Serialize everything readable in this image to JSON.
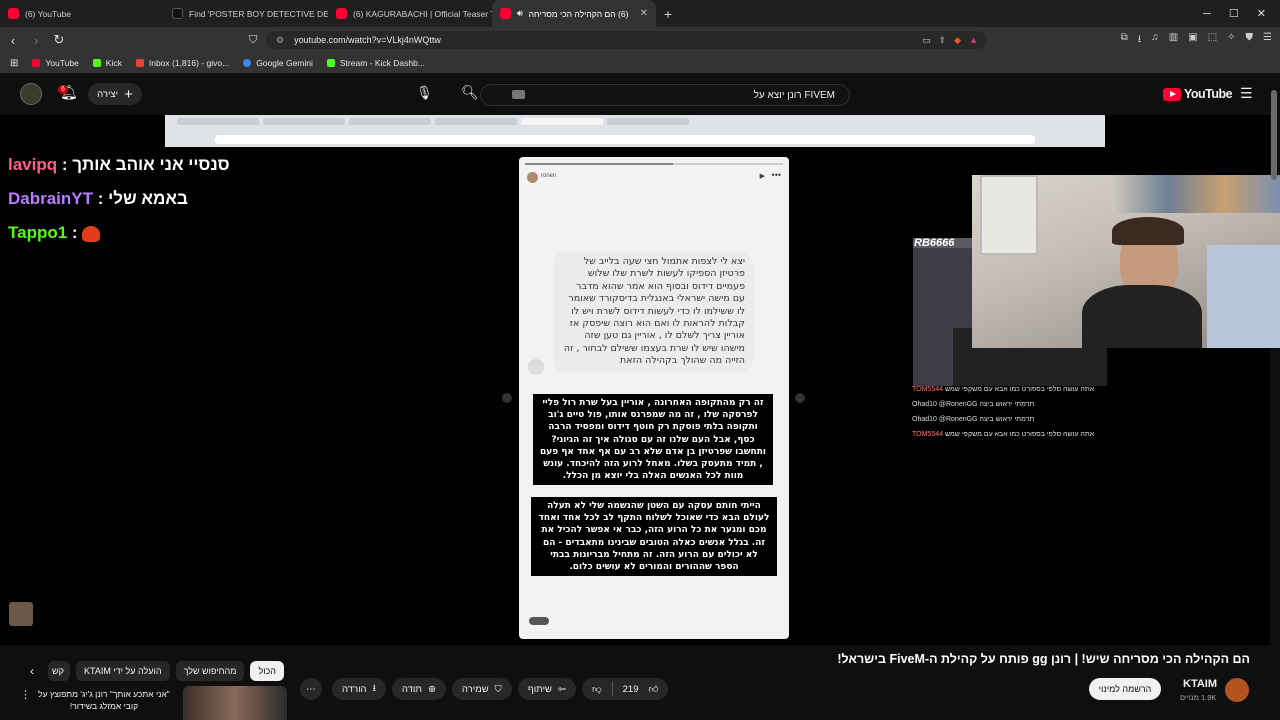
{
  "tabs": [
    {
      "label": "(6) YouTube",
      "color": "#ff0033"
    },
    {
      "label": "Find 'POSTER BOY DETECTIVE DEXTE",
      "color": "#111111"
    },
    {
      "label": "(6) KAGURABACHI | Official Teaser Tr",
      "color": "#ff0033"
    },
    {
      "label": "(6) הם הקהילה הכי מסריחה",
      "color": "#ff0033"
    }
  ],
  "url": "youtube.com/watch?v=VLkj4nWQttw",
  "bookmarks": [
    {
      "label": "YouTube",
      "color": "#ff0033"
    },
    {
      "label": "Kick",
      "color": "#53fc18"
    },
    {
      "label": "Inbox (1,816) - givo...",
      "color": "#ea4335"
    },
    {
      "label": "Google Gemini",
      "color": "#4285f4"
    },
    {
      "label": "Stream - Kick Dashb...",
      "color": "#53fc18"
    }
  ],
  "header": {
    "search_query": "רונן יוצא על FIVEM",
    "create_label": "יצירה",
    "notif_count": "6",
    "logo": "YouTube"
  },
  "video": {
    "chat": [
      {
        "user": "lavipq",
        "message": "סנסיי אני אוהב אותך",
        "color": "#ff5a86"
      },
      {
        "user": "DabrainYT",
        "message": "באמא שלי",
        "color": "#b77cff"
      },
      {
        "user": "Tappo1",
        "message": "",
        "color": "#53fc18"
      }
    ],
    "story_username": "ronen",
    "bubble_text": "יצא לי לצפות אתמול חצי שעה בלייב של פרטיזן הספיקו לעשות לשרת שלו שלוש פעמיים דידוס ובסוף הוא אמר שהוא מדבר עם מישה ישראלי באנגלית בדיסקורד שאומר לו ששילמו לו כדי לעשות דידוס לשרת ויש לו קבלות להראות לו ואם הוא רוצה שיפסק אז אוריין צריך לשלם לו , אוריין גם טען שזה מישהו שיש לו שרת בעצמו ששילם לבחור , זה הזייה מה שהולך בקהילה הזאת",
    "block1": "זה רק מהתקופה האחרונה , אוריין בעל שרת רול פליי לפרסקה שלו , זה מה שמפרנס אותו, פול טיים ג'וב ותקופה בלתי פוסקת רק חוטף דידוס ומפסיד הרבה כסף, אבל העם שלנו זה עם סגולה איך זה הגיוני? ותחשבו שפרטיזן בן אדם שלא רב עם אף אחד אף פעם , תמיד מתעסק בשלו. מאחל לרוע הזה להיכחד. עונש מוות לכל האנשים האלה בלי יוצא מן הכלל.",
    "block2": "הייתי חותם עסקה עם השטן שהנשמה שלי לא תעלה לעולם הבא כדי שאוכל לשלוח התקף לב לכל אחד ואחד מכם ומגער את כל הרוע הזה, כבר אי אפשר להכיל את זה. בגלל אנשים כאלה הטובים שבינינו מתאבדים - הם לא יכולים עם הרוע הזה. זה מתחיל מבריונות בבתי הספר שההורים והמורים לא עושים כלום.",
    "overlay_name": "RB6666",
    "overlay_chat": [
      {
        "user": "TOM5544",
        "text": "אתה עושה סלפי בספורט כמו אבא עם משקפי שמש",
        "color": "#ff7070"
      },
      {
        "user": "Ohad10",
        "text": "@RonenGG תרמתי יראוש ביצה",
        "color": "#f1f1f1"
      },
      {
        "user": "Ohad10",
        "text": "@RonenGG תרמתי יראוש ביצה",
        "color": "#f1f1f1"
      },
      {
        "user": "TOM5544",
        "text": "אתה עושה סלפי בספורט כמו אבא עם משקפי שמש",
        "color": "#ff7070"
      }
    ]
  },
  "below": {
    "title": "הם הקהילה הכי מסריחה שיש! | רונן gg פותח על קהילת ה-FiveM בישראל!",
    "channel": "KTAIM",
    "subs": "1.9K מנויים",
    "subscribe": "הרשמה למינוי",
    "likes": "219",
    "share": "שיתוף",
    "save": "שמירה",
    "thanks": "תודה",
    "download": "הורדה",
    "chips": [
      "הכול",
      "מהחיפוש שלך",
      "הועלה על ידי KTAIM",
      "קש"
    ],
    "rec_title": "\"אני אתכע אותך\" רונן ג'יג' מתפוצץ על קובי אמזלג בשידור!"
  }
}
